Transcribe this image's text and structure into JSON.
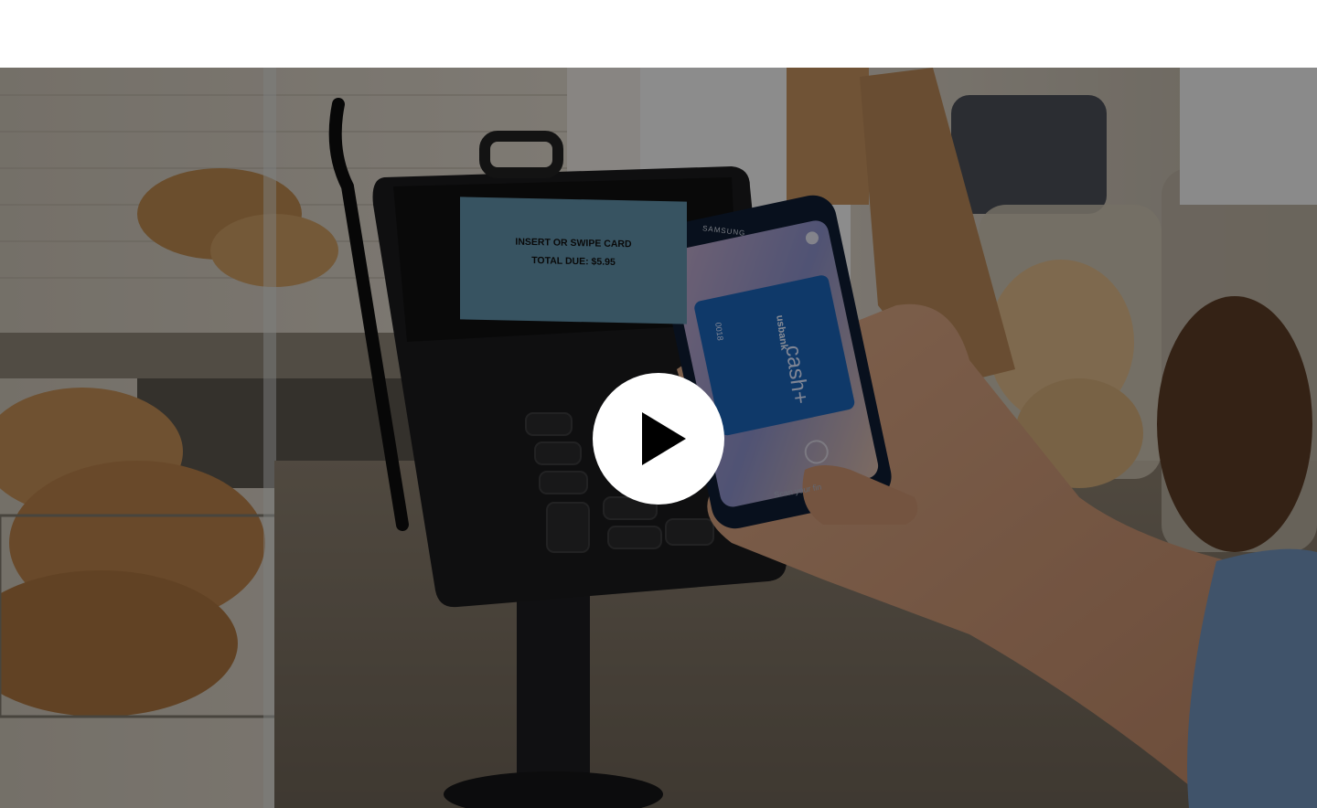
{
  "video": {
    "thumbnail": {
      "terminal_line_1": "INSERT OR SWIPE CARD",
      "terminal_line_2": "TOTAL DUE: $5.95",
      "phone_brand": "SAMSUNG",
      "card_bank": "usbank",
      "card_name": "cash+",
      "card_number": "0018",
      "scan_prompt": "Scan your fin"
    },
    "overlay_dim": "rgba(0,0,0,0.42)",
    "play_icon": "play-icon",
    "play_button_color": "#ffffff"
  }
}
